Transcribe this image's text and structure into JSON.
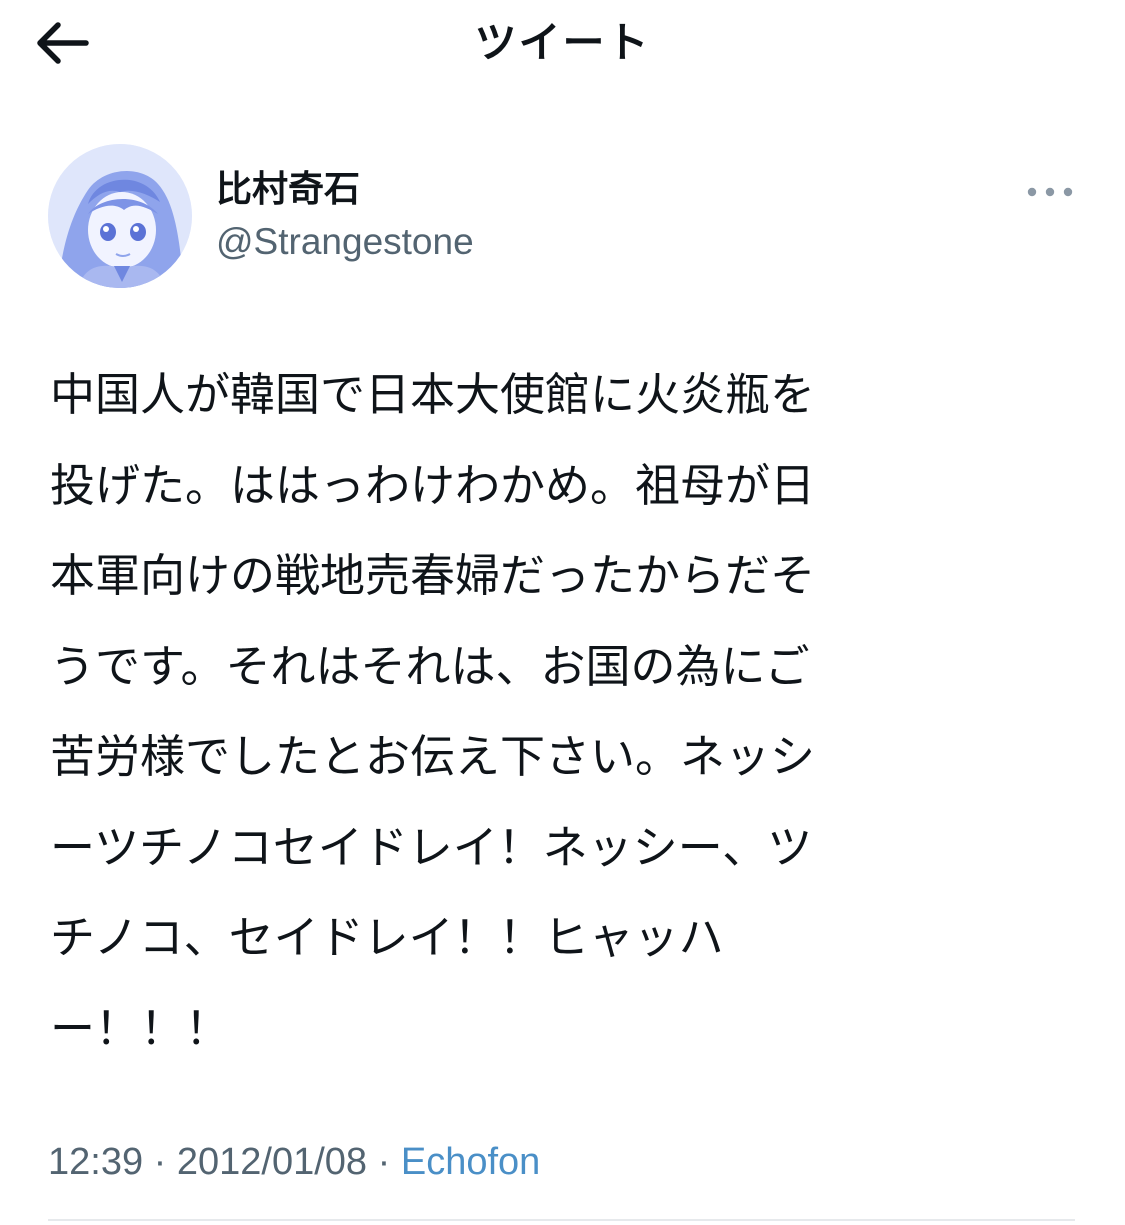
{
  "header": {
    "title": "ツイート",
    "back_icon": "arrow-left-icon"
  },
  "author": {
    "display_name": "比村奇石",
    "handle": "@Strangestone",
    "avatar_icon": "anime-girl-avatar"
  },
  "more_icon": "more-horizontal-icon",
  "tweet": {
    "lines": [
      "中国人が韓国で日本大使館に火炎瓶を",
      "投げた。ははっわけわかめ。祖母が日",
      "本軍向けの戦地売春婦だったからだそ",
      "うです。それはそれは、お国の為にご",
      "苦労様でしたとお伝え下さい。ネッシ",
      "ーツチノコセイドレイ！ネッシー、ツ",
      "チノコ、セイドレイ！！ヒャッハ",
      "ー！！！"
    ]
  },
  "meta": {
    "time": "12:39",
    "separator": " · ",
    "date": "2012/01/08",
    "source": "Echofon"
  },
  "colors": {
    "text": "#0f1419",
    "secondary": "#536471",
    "link": "#4a8fc7",
    "divider": "#e6e9ec"
  }
}
